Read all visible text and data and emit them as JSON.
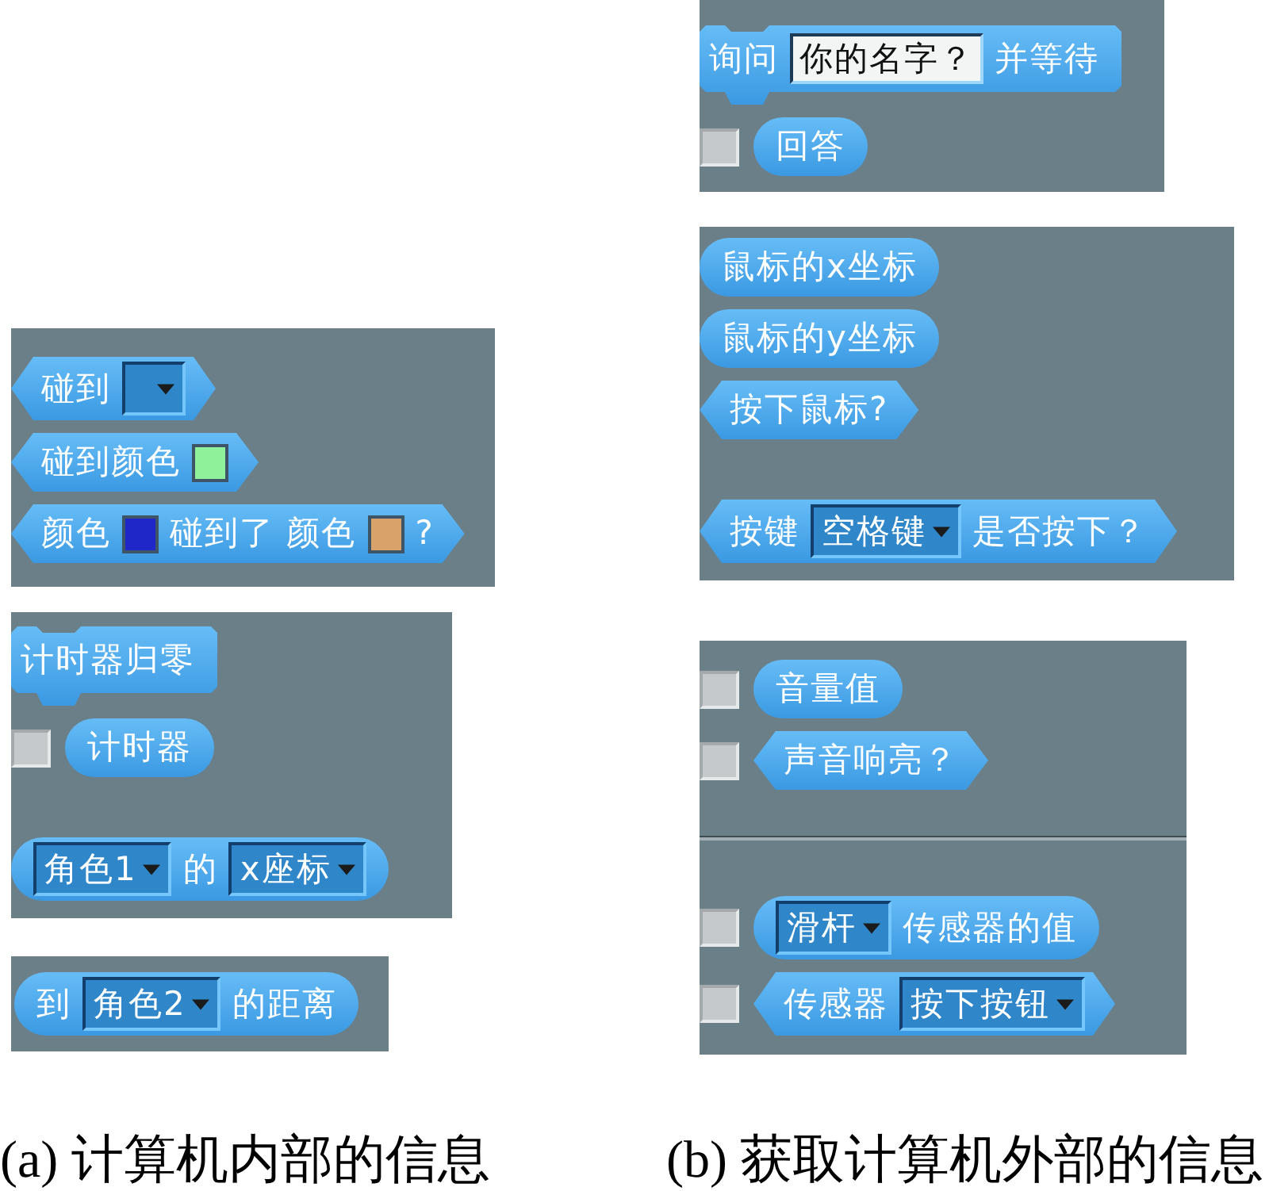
{
  "columns": [
    {
      "panels": [
        {
          "groups": [
            [
              {
                "kind": "boolean",
                "parts": [
                  {
                    "kind": "text",
                    "text": "碰到"
                  },
                  {
                    "kind": "dropdown"
                  }
                ]
              },
              {
                "kind": "boolean",
                "parts": [
                  {
                    "kind": "text",
                    "text": "碰到颜色"
                  },
                  {
                    "kind": "color",
                    "color": "#8ff29b"
                  }
                ]
              },
              {
                "kind": "boolean",
                "parts": [
                  {
                    "kind": "text",
                    "text": "颜色"
                  },
                  {
                    "kind": "color",
                    "color": "#1f27c9"
                  },
                  {
                    "kind": "text",
                    "text": "碰到了 颜色"
                  },
                  {
                    "kind": "color",
                    "color": "#d7a36a"
                  },
                  {
                    "kind": "text",
                    "text": "?"
                  }
                ]
              }
            ]
          ]
        },
        {
          "groups": [
            [
              {
                "kind": "stack",
                "parts": [
                  {
                    "kind": "text",
                    "text": "计时器归零"
                  }
                ]
              },
              {
                "kind": "reporter",
                "checkbox": {
                  "checked": false
                },
                "parts": [
                  {
                    "kind": "text",
                    "text": "计时器"
                  }
                ]
              }
            ],
            [
              {
                "kind": "reporter",
                "parts": [
                  {
                    "kind": "dropdown",
                    "value": "角色1"
                  },
                  {
                    "kind": "text",
                    "text": "的"
                  },
                  {
                    "kind": "dropdown",
                    "value": "x座标"
                  }
                ]
              }
            ]
          ]
        },
        {
          "groups": [
            [
              {
                "kind": "reporter",
                "parts": [
                  {
                    "kind": "text",
                    "text": "到"
                  },
                  {
                    "kind": "dropdown",
                    "value": "角色2"
                  },
                  {
                    "kind": "text",
                    "text": "的距离"
                  }
                ]
              }
            ]
          ]
        }
      ],
      "caption": "(a) 计算机内部的信息"
    },
    {
      "panels": [
        {
          "groups": [
            [
              {
                "kind": "stack",
                "parts": [
                  {
                    "kind": "text",
                    "text": "询问"
                  },
                  {
                    "kind": "input",
                    "value": "你的名字？"
                  },
                  {
                    "kind": "text",
                    "text": "并等待"
                  }
                ]
              },
              {
                "kind": "reporter",
                "checkbox": {
                  "checked": false
                },
                "parts": [
                  {
                    "kind": "text",
                    "text": "回答"
                  }
                ]
              }
            ]
          ]
        },
        {
          "groups": [
            [
              {
                "kind": "reporter",
                "parts": [
                  {
                    "kind": "text",
                    "text": "鼠标的x坐标"
                  }
                ]
              },
              {
                "kind": "reporter",
                "parts": [
                  {
                    "kind": "text",
                    "text": "鼠标的y坐标"
                  }
                ]
              },
              {
                "kind": "boolean",
                "parts": [
                  {
                    "kind": "text",
                    "text": "按下鼠标?"
                  }
                ]
              }
            ],
            [
              {
                "kind": "boolean",
                "parts": [
                  {
                    "kind": "text",
                    "text": "按键"
                  },
                  {
                    "kind": "dropdown",
                    "value": "空格键"
                  },
                  {
                    "kind": "text",
                    "text": "是否按下？"
                  }
                ]
              }
            ]
          ]
        },
        {
          "divider": true,
          "groups": [
            [
              {
                "kind": "reporter",
                "checkbox": {
                  "checked": false
                },
                "parts": [
                  {
                    "kind": "text",
                    "text": "音量值"
                  }
                ]
              },
              {
                "kind": "boolean",
                "checkbox": {
                  "checked": false
                },
                "parts": [
                  {
                    "kind": "text",
                    "text": "声音响亮？"
                  }
                ]
              }
            ],
            [
              {
                "kind": "reporter",
                "checkbox": {
                  "checked": false
                },
                "parts": [
                  {
                    "kind": "dropdown",
                    "value": "滑杆"
                  },
                  {
                    "kind": "text",
                    "text": "传感器的值"
                  }
                ]
              },
              {
                "kind": "boolean",
                "checkbox": {
                  "checked": false
                },
                "parts": [
                  {
                    "kind": "text",
                    "text": "传感器"
                  },
                  {
                    "kind": "dropdown",
                    "value": "按下按钮"
                  }
                ]
              }
            ]
          ]
        }
      ],
      "caption": "(b) 获取计算机外部的信息"
    }
  ]
}
